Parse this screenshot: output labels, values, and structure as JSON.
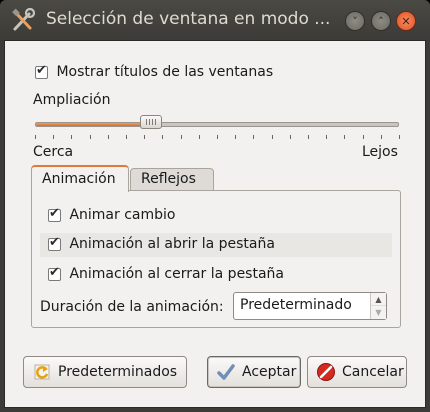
{
  "window": {
    "title": "Selección de ventana en modo ...",
    "icon": "tools-icon",
    "controls": {
      "minimize": "chevron-down-icon",
      "maximize": "chevron-up-icon",
      "close": "close-icon"
    }
  },
  "options": {
    "show_titles_label": "Mostrar títulos de las ventanas",
    "show_titles_checked": true
  },
  "zoom": {
    "label": "Ampliación",
    "value_fraction": 0.32,
    "min_label": "Cerca",
    "max_label": "Lejos"
  },
  "tabs": [
    {
      "label": "Animación",
      "active": true
    },
    {
      "label": "Reflejos",
      "active": false
    }
  ],
  "animation": {
    "animate_change_label": "Animar cambio",
    "animate_change_checked": true,
    "animate_open_label": "Animación al abrir la pestaña",
    "animate_open_checked": true,
    "animate_close_label": "Animación al cerrar la pestaña",
    "animate_close_checked": true,
    "duration_label": "Duración de la animación:",
    "duration_value": "Predeterminado"
  },
  "buttons": {
    "defaults": "Predeterminados",
    "accept": "Aceptar",
    "cancel": "Cancelar"
  },
  "colors": {
    "accent": "#e06a1e",
    "close": "#e0512a"
  }
}
